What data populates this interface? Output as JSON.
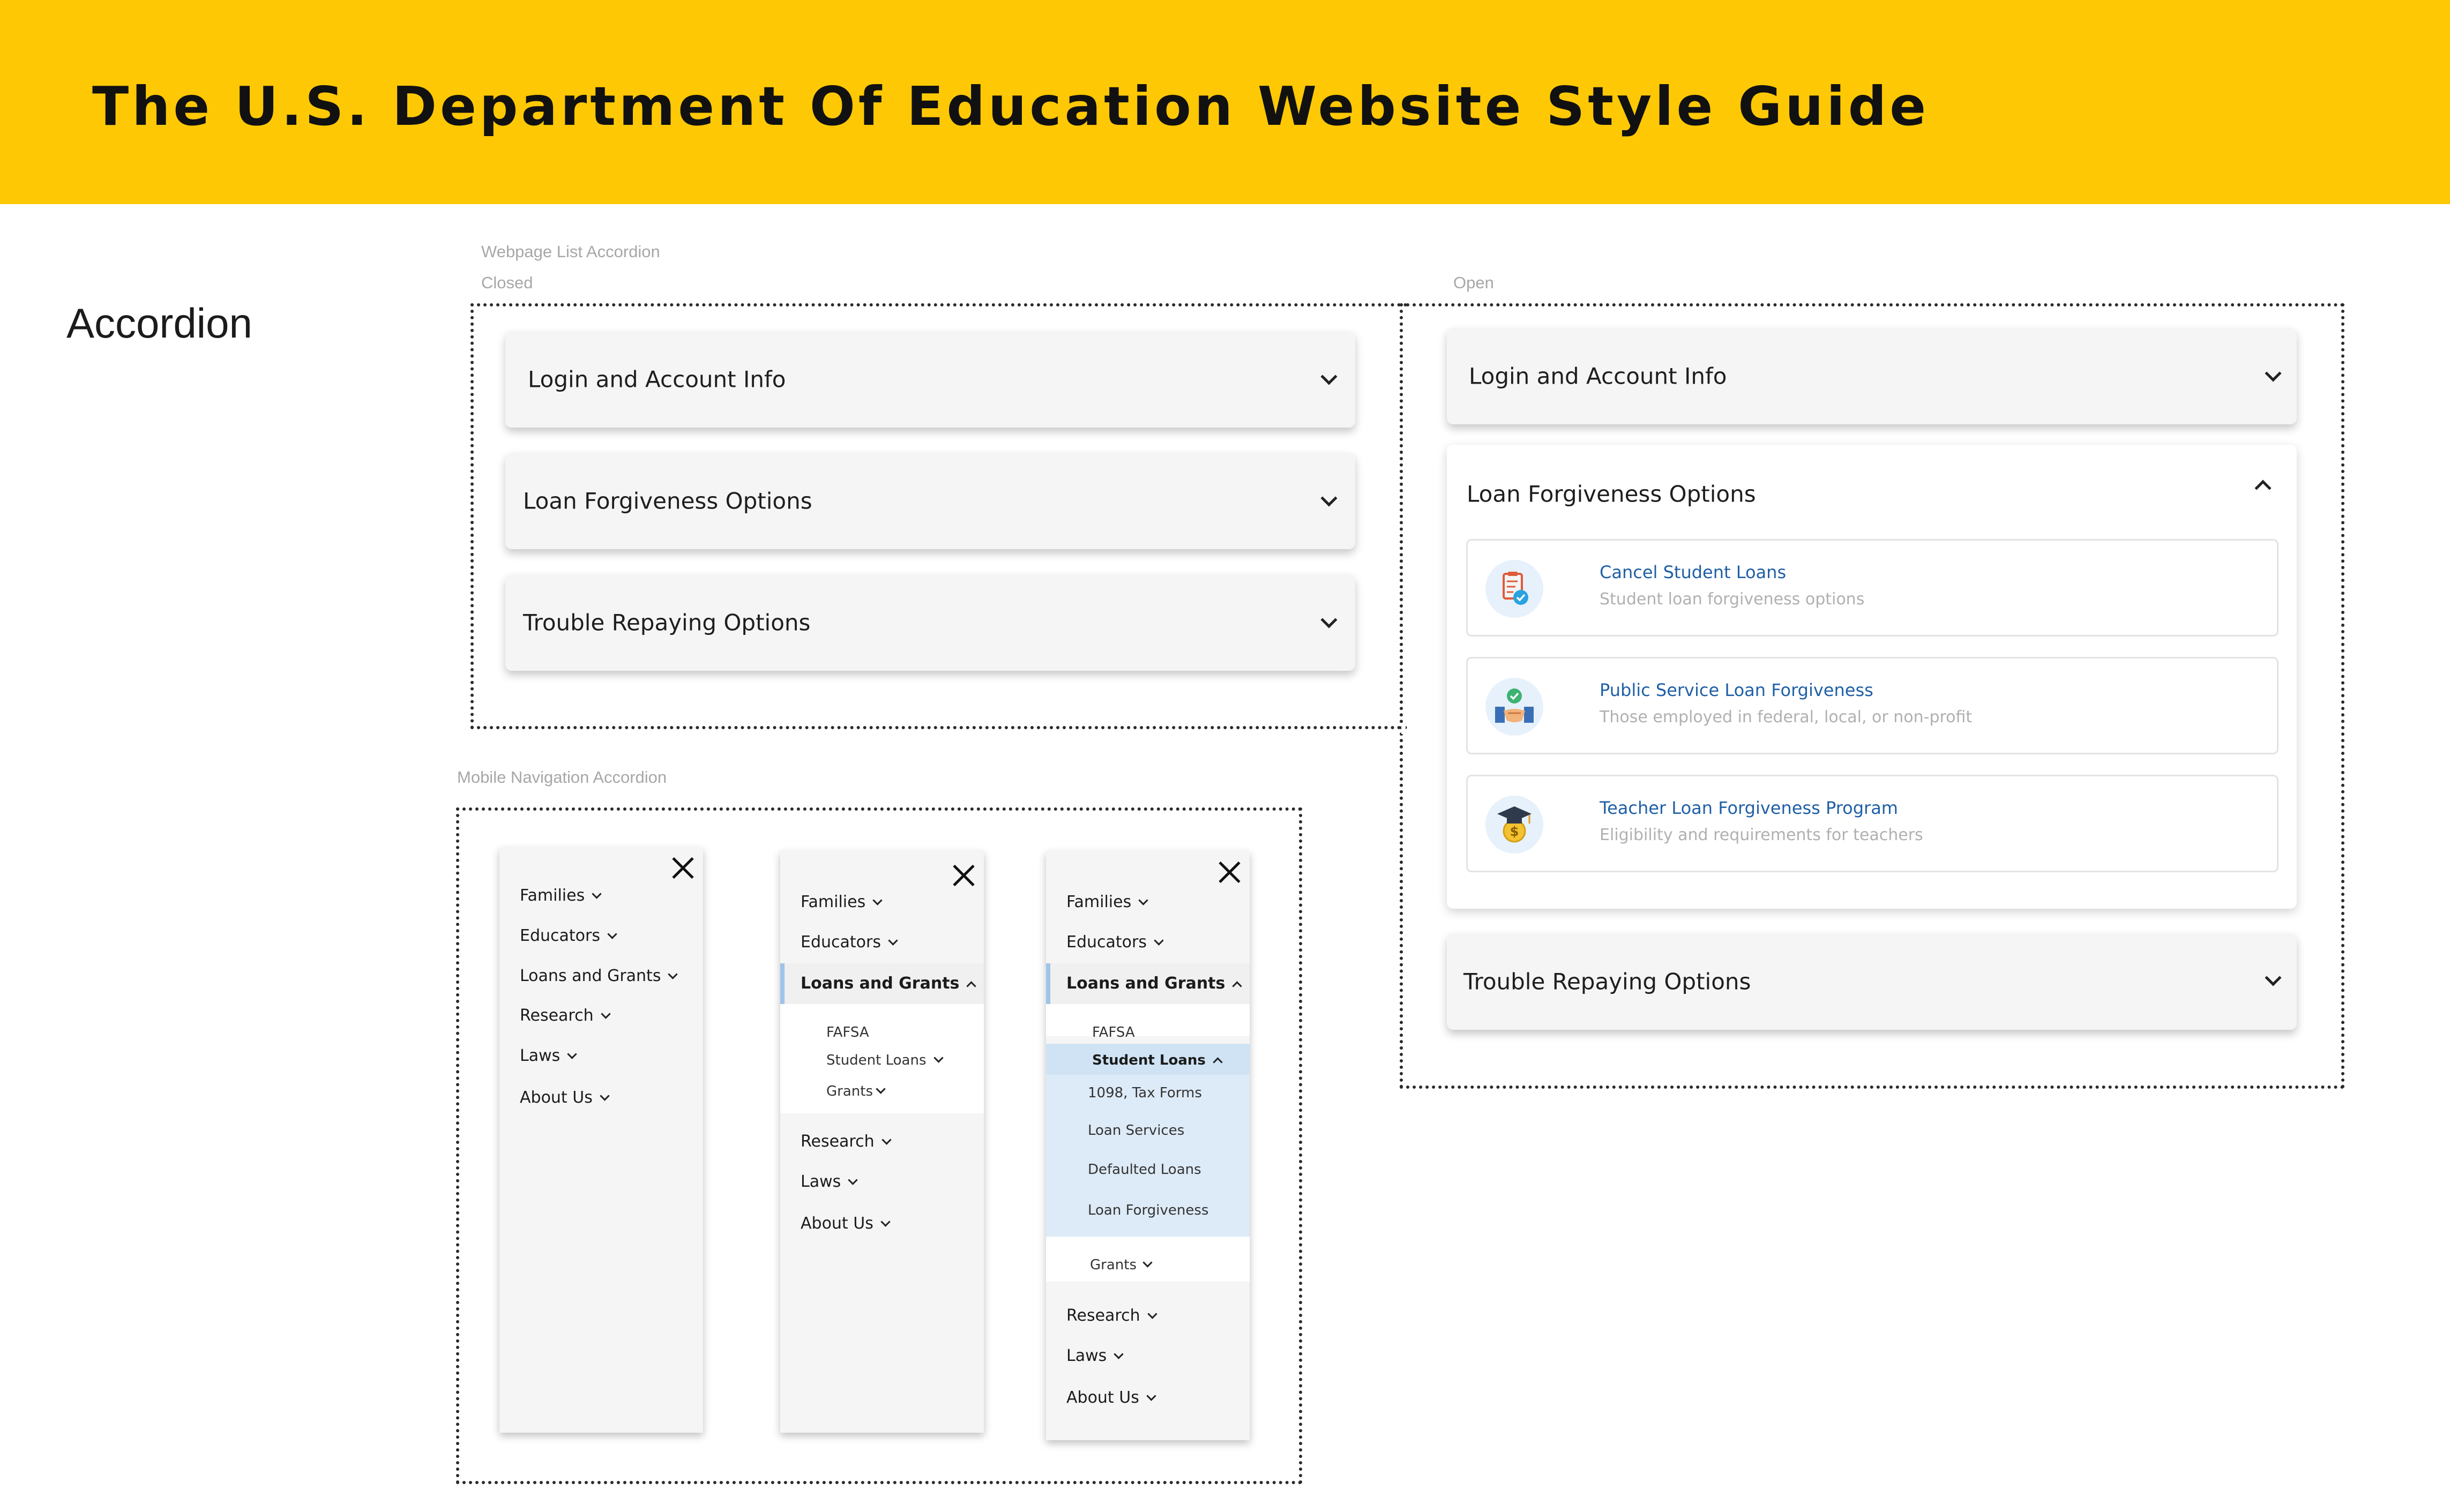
{
  "header": {
    "title": "The U.S. Department Of Education Website Style Guide",
    "background_color": "#fec804"
  },
  "section": {
    "title": "Accordion"
  },
  "captions": {
    "webpage_list": "Webpage List Accordion",
    "closed": "Closed",
    "open": "Open",
    "mobile_nav": "Mobile Navigation Accordion"
  },
  "closed_accordion": {
    "items": [
      {
        "label": "Login and Account Info",
        "icon": "chevron-down-icon"
      },
      {
        "label": "Loan Forgiveness Options",
        "icon": "chevron-down-icon"
      },
      {
        "label": "Trouble Repaying Options",
        "icon": "chevron-down-icon"
      }
    ]
  },
  "open_accordion": {
    "items": [
      {
        "label": "Login and Account Info",
        "icon": "chevron-down-icon"
      },
      {
        "label": "Loan Forgiveness Options",
        "icon": "chevron-up-icon",
        "expanded": true
      },
      {
        "label": "Trouble Repaying Options",
        "icon": "chevron-down-icon"
      }
    ],
    "cards": [
      {
        "title": "Cancel Student Loans",
        "subtitle": "Student loan forgiveness options",
        "icon": "clipboard-check-icon"
      },
      {
        "title": "Public Service Loan Forgiveness",
        "subtitle": "Those employed in federal, local, or non-profit",
        "icon": "handshake-icon"
      },
      {
        "title": "Teacher Loan Forgiveness Program",
        "subtitle": "Eligibility and requirements for teachers",
        "icon": "graduation-cap-coin-icon"
      }
    ],
    "link_color": "#1f5fa6"
  },
  "mobile_nav": {
    "top_items": [
      "Families",
      "Educators",
      "Loans and Grants",
      "Research",
      "Laws",
      "About Us"
    ],
    "loans_sub_items": [
      "FAFSA",
      "Student Loans",
      "Grants"
    ],
    "student_loans_sub_items": [
      "1098, Tax Forms",
      "Loan Services",
      "Defaulted Loans",
      "Loan Forgiveness"
    ],
    "close_icon": "close-icon",
    "highlight_color": "#cfe3f5"
  }
}
